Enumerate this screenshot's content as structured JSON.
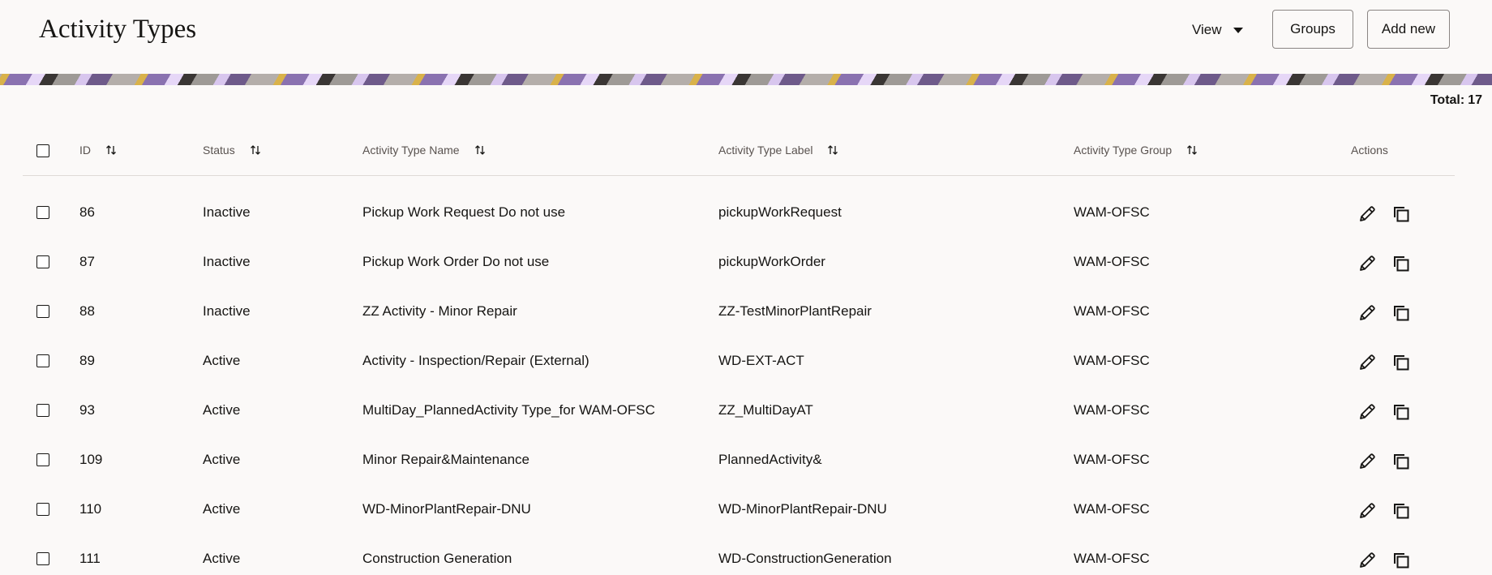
{
  "header": {
    "title": "Activity Types",
    "view_label": "View",
    "groups_label": "Groups",
    "add_new_label": "Add new"
  },
  "summary": {
    "total_label": "Total:",
    "total_value": "17"
  },
  "table": {
    "columns": {
      "id": "ID",
      "status": "Status",
      "name": "Activity Type Name",
      "label": "Activity Type Label",
      "group": "Activity Type Group",
      "actions": "Actions"
    },
    "rows": [
      {
        "id": "86",
        "status": "Inactive",
        "name": "Pickup Work Request Do not use",
        "label": "pickupWorkRequest",
        "group": "WAM-OFSC"
      },
      {
        "id": "87",
        "status": "Inactive",
        "name": "Pickup Work Order Do not use",
        "label": "pickupWorkOrder",
        "group": "WAM-OFSC"
      },
      {
        "id": "88",
        "status": "Inactive",
        "name": "ZZ Activity - Minor Repair",
        "label": "ZZ-TestMinorPlantRepair",
        "group": "WAM-OFSC"
      },
      {
        "id": "89",
        "status": "Active",
        "name": "Activity - Inspection/Repair (External)",
        "label": "WD-EXT-ACT",
        "group": "WAM-OFSC"
      },
      {
        "id": "93",
        "status": "Active",
        "name": "MultiDay_PlannedActivity Type_for WAM-OFSC",
        "label": "ZZ_MultiDayAT",
        "group": "WAM-OFSC"
      },
      {
        "id": "109",
        "status": "Active",
        "name": "Minor Repair&Maintenance",
        "label": "PlannedActivity&",
        "group": "WAM-OFSC"
      },
      {
        "id": "110",
        "status": "Active",
        "name": "WD-MinorPlantRepair-DNU",
        "label": "WD-MinorPlantRepair-DNU",
        "group": "WAM-OFSC"
      },
      {
        "id": "111",
        "status": "Active",
        "name": "Construction Generation",
        "label": "WD-ConstructionGeneration",
        "group": "WAM-OFSC"
      }
    ]
  },
  "icons": {
    "sort": "sort-arrows-icon",
    "edit": "pencil-icon",
    "copy": "duplicate-icon",
    "view_caret": "caret-down-icon"
  }
}
